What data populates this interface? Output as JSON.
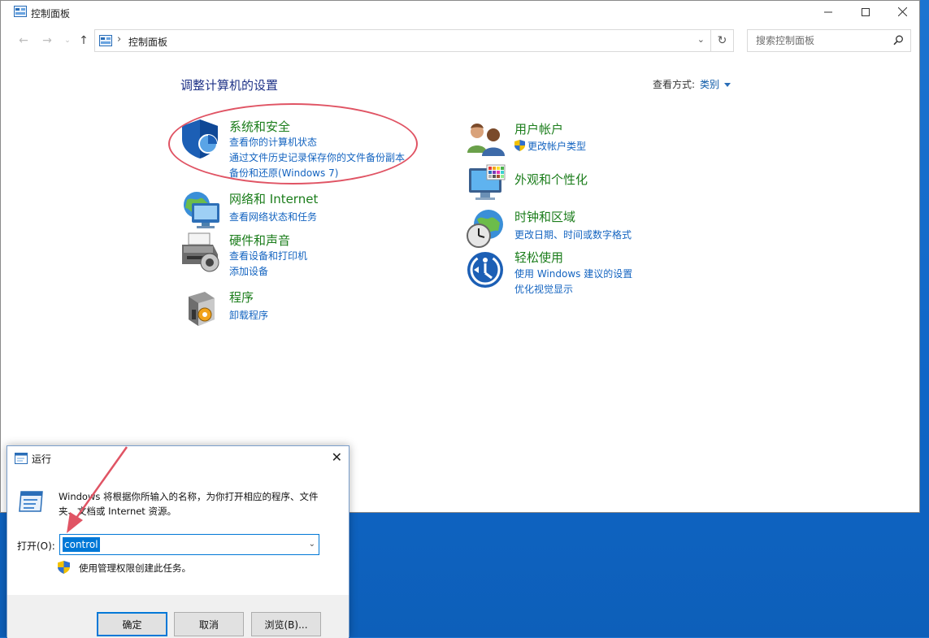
{
  "window": {
    "title": "控制面板",
    "controls": {
      "minimize": "—",
      "maximize": "☐",
      "close": "✕"
    }
  },
  "address": {
    "segment": "控制面板",
    "chevron": "›"
  },
  "search": {
    "placeholder": "搜索控制面板"
  },
  "page": {
    "title": "调整计算机的设置",
    "view_by_label": "查看方式:",
    "view_by_value": "类别"
  },
  "categories": {
    "system_security": {
      "title": "系统和安全",
      "links": [
        "查看你的计算机状态",
        "通过文件历史记录保存你的文件备份副本",
        "备份和还原(Windows 7)"
      ]
    },
    "network": {
      "title": "网络和 Internet",
      "links": [
        "查看网络状态和任务"
      ]
    },
    "hardware": {
      "title": "硬件和声音",
      "links": [
        "查看设备和打印机",
        "添加设备"
      ]
    },
    "programs": {
      "title": "程序",
      "links": [
        "卸载程序"
      ]
    },
    "user_accounts": {
      "title": "用户帐户",
      "links": [
        "更改帐户类型"
      ]
    },
    "appearance": {
      "title": "外观和个性化",
      "links": []
    },
    "clock_region": {
      "title": "时钟和区域",
      "links": [
        "更改日期、时间或数字格式"
      ]
    },
    "ease_of_access": {
      "title": "轻松使用",
      "links": [
        "使用 Windows 建议的设置",
        "优化视觉显示"
      ]
    }
  },
  "run_dialog": {
    "title": "运行",
    "close": "✕",
    "description": "Windows 将根据你所输入的名称，为你打开相应的程序、文件夹、文档或 Internet 资源。",
    "open_label": "打开(O):",
    "input_value": "control",
    "admin_note": "使用管理权限创建此任务。",
    "ok_label": "确定",
    "cancel_label": "取消",
    "browse_label": "浏览(B)..."
  },
  "colors": {
    "category_title": "#1b7d1b",
    "link": "#1464c0",
    "highlight": "#e05464",
    "desktop": "#1c74d0"
  }
}
